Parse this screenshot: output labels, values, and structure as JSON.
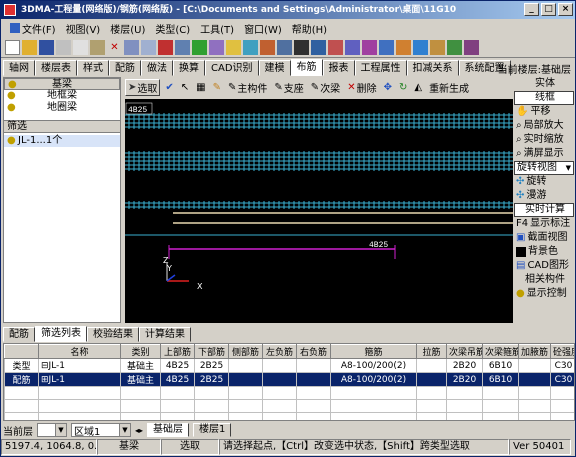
{
  "window": {
    "title": "3DMA-工程量(网络版)/钢筋(网络版) - [C:\\Documents and Settings\\Administrator\\桌面\\11G10",
    "min": "_",
    "max": "□",
    "close": "×"
  },
  "menu": [
    "文件(F)",
    "视图(V)",
    "楼层(U)",
    "类型(C)",
    "工具(T)",
    "窗口(W)",
    "帮助(H)"
  ],
  "tabs": [
    "轴网",
    "楼层表",
    "样式",
    "配筋",
    "做法",
    "换算",
    "CAD识别",
    "建模",
    "布筋",
    "报表",
    "工程属性",
    "扣减关系",
    "系统配置"
  ],
  "active_tab": "布筋",
  "current_floor_label": "当前楼层:基础层",
  "left_panel": {
    "tree": [
      "基梁",
      "地框梁",
      "地圈梁"
    ],
    "filter_label": "筛选",
    "items": [
      "JL-1...1个"
    ]
  },
  "draw_toolbar": {
    "select": "选取",
    "main": "主构件",
    "support": "支座",
    "secondary": "次梁",
    "delete": "删除",
    "redraw": "重新生成"
  },
  "right_panel": {
    "entity": "实体",
    "wireframe": "线框",
    "pan": "平移",
    "zoom_local": "局部放大",
    "zoom_live": "实时缩放",
    "zoom_full": "满屏显示",
    "rotate_view": "旋转视图",
    "rotate": "旋转",
    "roam": "漫游",
    "live_calc": "实时计算",
    "f4_label": "F4",
    "show_label": "显示标注",
    "section_view": "截面视图",
    "bg_color": "背景色",
    "cad_graphic": "CAD图形",
    "related": "相关构件",
    "show_ctrl": "显示控制"
  },
  "canvas": {
    "label_top": "4B25",
    "label_mid": "4B25",
    "axis_x": "X",
    "axis_y": "Y",
    "axis_z": "Z"
  },
  "bottom_tabs": [
    "配筋",
    "筛选列表",
    "校验结果",
    "计算结果"
  ],
  "active_bottom_tab": "筛选列表",
  "table": {
    "headers": [
      "",
      "名称",
      "类别",
      "上部筋",
      "下部筋",
      "侧部筋",
      "左负筋",
      "右负筋",
      "箍筋",
      "拉筋",
      "次梁吊筋",
      "次梁箍筋",
      "加腋筋",
      "砼强度"
    ],
    "rows": [
      [
        "类型",
        "⊟JL-1",
        "基础主",
        "4B25",
        "2B25",
        "",
        "",
        "",
        "A8-100/200(2)",
        "",
        "2B20",
        "6B10",
        "",
        "C30"
      ],
      [
        "配筋",
        "⊞JL-1",
        "基础主",
        "4B25",
        "2B25",
        "",
        "",
        "",
        "A8-100/200(2)",
        "",
        "2B20",
        "6B10",
        "",
        "C30"
      ]
    ]
  },
  "floor_bar": {
    "current_label": "当前层",
    "zone": "区域1",
    "floor_tabs": [
      "基础层",
      "楼层1"
    ]
  },
  "status": {
    "coords": "5197.4, 1064.8, 0.0",
    "type": "基梁",
    "mode": "选取",
    "hint": "请选择起点,【Ctrl】改变选中状态,【Shift】跨类型选取",
    "version": "Ver 50401"
  }
}
